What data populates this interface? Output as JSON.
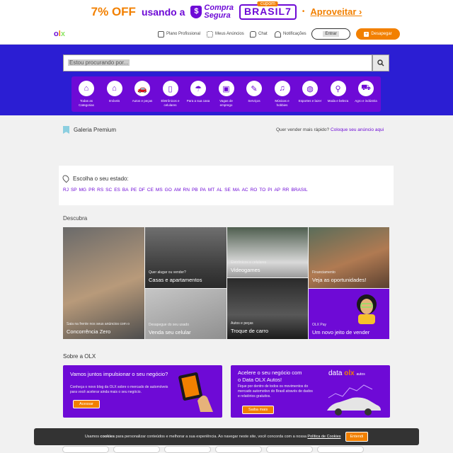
{
  "promo": {
    "percent": "7%",
    "off": "OFF",
    "text": "usando a",
    "compra_line1": "Compra",
    "compra_line2": "Segura",
    "coupon_label": "cupom",
    "coupon_code": "BRASIL7",
    "dot": "•",
    "cta": "Aproveitar ›"
  },
  "header": {
    "logo": [
      "o",
      "l",
      "x"
    ],
    "nav": [
      {
        "label": "Plano Profissional",
        "icon": "briefcase-icon"
      },
      {
        "label": "Meus Anúncios",
        "icon": "grid-icon"
      },
      {
        "label": "Chat",
        "icon": "chat-icon"
      },
      {
        "label": "Notificações",
        "icon": "bell-icon"
      }
    ],
    "login": "Entrar",
    "sell": "Desapegar"
  },
  "search": {
    "placeholder": "Estou procurando por..."
  },
  "categories": [
    {
      "label": "Todas as Categorias",
      "glyph": "⌂"
    },
    {
      "label": "Imóveis",
      "glyph": "⌂"
    },
    {
      "label": "Autos e peças",
      "glyph": "🚗"
    },
    {
      "label": "Eletrônicos e celulares",
      "glyph": "▯"
    },
    {
      "label": "Para a sua casa",
      "glyph": "☂"
    },
    {
      "label": "Vagas de emprego",
      "glyph": "▣"
    },
    {
      "label": "Serviços",
      "glyph": "✎"
    },
    {
      "label": "Músicas e hobbies",
      "glyph": "♫"
    },
    {
      "label": "Esportes e lazer",
      "glyph": "◍"
    },
    {
      "label": "Moda e beleza",
      "glyph": "⚲"
    },
    {
      "label": "Agro e indústria",
      "glyph": "⛟"
    }
  ],
  "galeria": {
    "title": "Galeria Premium",
    "question": "Quer vender mais rápido?",
    "link": "Coloque seu anúncio aqui"
  },
  "states": {
    "title": "Escolha o seu estado:",
    "list": [
      "RJ",
      "SP",
      "MG",
      "PR",
      "RS",
      "SC",
      "ES",
      "BA",
      "PE",
      "DF",
      "CE",
      "MS",
      "GO",
      "AM",
      "RN",
      "PB",
      "PA",
      "MT",
      "AL",
      "SE",
      "MA",
      "AC",
      "RO",
      "TO",
      "PI",
      "AP",
      "RR",
      "BRASIL"
    ]
  },
  "descubra": {
    "title": "Descubra",
    "tiles": [
      {
        "sub": "Saia na frente nos seus anúncios com o",
        "title": "Concorrência Zero"
      },
      {
        "sub": "Quer alugar ou vender?",
        "title": "Casas e apartamentos"
      },
      {
        "sub": "Desapegue do seu usado",
        "title": "Venda seu celular"
      },
      {
        "sub": "Eletrônicos e celulares",
        "title": "Videogames"
      },
      {
        "sub": "Autos e peças",
        "title": "Troque de carro"
      },
      {
        "sub": "Financiamento",
        "title": "Veja as oportunidades!"
      },
      {
        "sub": "OLX Pay",
        "title": "Um novo jeito de vender"
      }
    ]
  },
  "about": {
    "title": "Sobre a OLX",
    "card1": {
      "title": "Vamos juntos impulsionar o seu negócio?",
      "text": "Conheça o novo blog da OLX sobre o mercado de automóveis para você acelerar ainda mais o seu negócio.",
      "button": "Acessar"
    },
    "card2": {
      "title_line1": "Acelere o seu negócio com",
      "title_line2": "o Data OLX Autos!",
      "text": "Fique por dentro de todos os movimentos do mercado automotivo do Brasil através de dados e relatórios gratuitos.",
      "button": "Saiba mais",
      "brand": "data",
      "brand_sub": "autos"
    }
  },
  "cookie": {
    "text_before": "Usamos",
    "bold": "cookies",
    "text_after": "para personalizar conteúdos e melhorar a sua experiência. Ao navegar neste site, você concorda com a nossa",
    "link": "Política de Cookies",
    "button": "Entendi"
  }
}
